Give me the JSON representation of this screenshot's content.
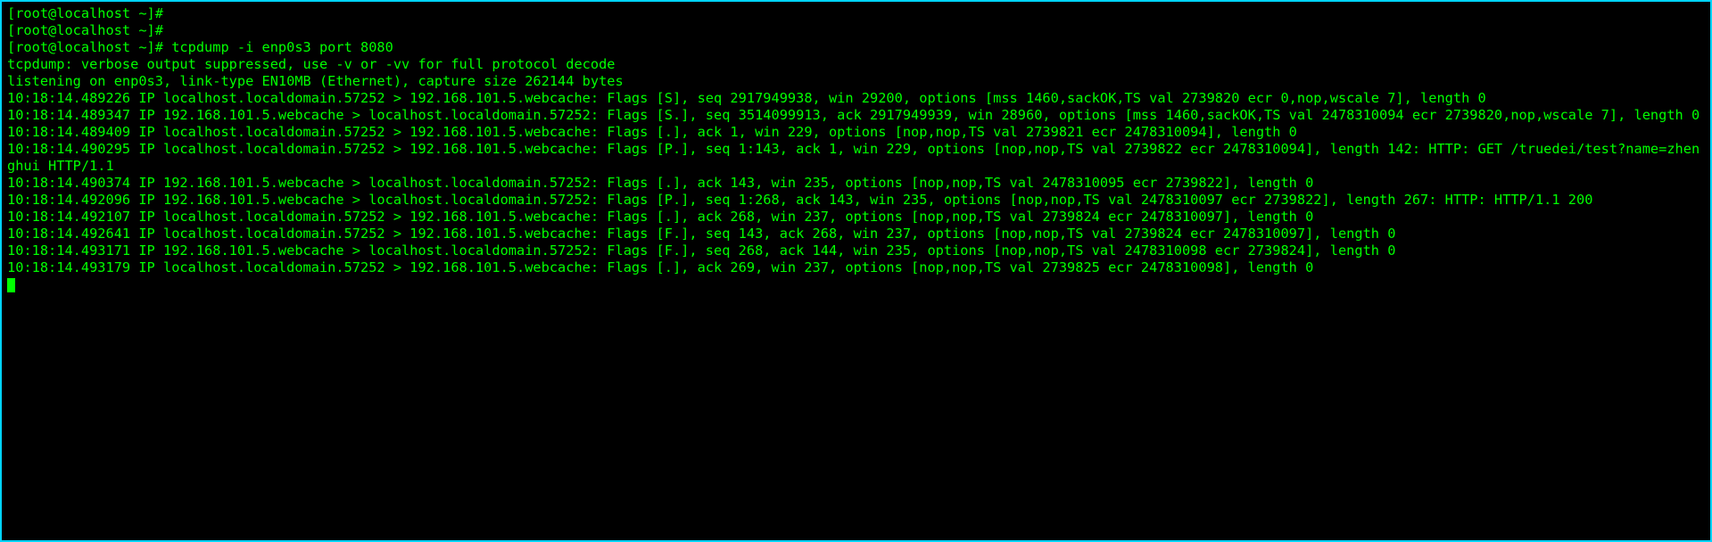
{
  "terminal": {
    "lines": [
      {
        "prompt": "[root@localhost ~]#",
        "cmd": " "
      },
      {
        "prompt": "[root@localhost ~]#",
        "cmd": " "
      },
      {
        "prompt": "[root@localhost ~]#",
        "cmd": " tcpdump -i enp0s3 port 8080"
      },
      {
        "text": "tcpdump: verbose output suppressed, use -v or -vv for full protocol decode"
      },
      {
        "text": "listening on enp0s3, link-type EN10MB (Ethernet), capture size 262144 bytes"
      },
      {
        "text": "10:18:14.489226 IP localhost.localdomain.57252 > 192.168.101.5.webcache: Flags [S], seq 2917949938, win 29200, options [mss 1460,sackOK,TS val 2739820 ecr 0,nop,wscale 7], length 0"
      },
      {
        "text": "10:18:14.489347 IP 192.168.101.5.webcache > localhost.localdomain.57252: Flags [S.], seq 3514099913, ack 2917949939, win 28960, options [mss 1460,sackOK,TS val 2478310094 ecr 2739820,nop,wscale 7], length 0"
      },
      {
        "text": "10:18:14.489409 IP localhost.localdomain.57252 > 192.168.101.5.webcache: Flags [.], ack 1, win 229, options [nop,nop,TS val 2739821 ecr 2478310094], length 0"
      },
      {
        "text": "10:18:14.490295 IP localhost.localdomain.57252 > 192.168.101.5.webcache: Flags [P.], seq 1:143, ack 1, win 229, options [nop,nop,TS val 2739822 ecr 2478310094], length 142: HTTP: GET /truedei/test?name=zhenghui HTTP/1.1"
      },
      {
        "text": "10:18:14.490374 IP 192.168.101.5.webcache > localhost.localdomain.57252: Flags [.], ack 143, win 235, options [nop,nop,TS val 2478310095 ecr 2739822], length 0"
      },
      {
        "text": "10:18:14.492096 IP 192.168.101.5.webcache > localhost.localdomain.57252: Flags [P.], seq 1:268, ack 143, win 235, options [nop,nop,TS val 2478310097 ecr 2739822], length 267: HTTP: HTTP/1.1 200"
      },
      {
        "text": "10:18:14.492107 IP localhost.localdomain.57252 > 192.168.101.5.webcache: Flags [.], ack 268, win 237, options [nop,nop,TS val 2739824 ecr 2478310097], length 0"
      },
      {
        "text": "10:18:14.492641 IP localhost.localdomain.57252 > 192.168.101.5.webcache: Flags [F.], seq 143, ack 268, win 237, options [nop,nop,TS val 2739824 ecr 2478310097], length 0"
      },
      {
        "text": "10:18:14.493171 IP 192.168.101.5.webcache > localhost.localdomain.57252: Flags [F.], seq 268, ack 144, win 235, options [nop,nop,TS val 2478310098 ecr 2739824], length 0"
      },
      {
        "text": "10:18:14.493179 IP localhost.localdomain.57252 > 192.168.101.5.webcache: Flags [.], ack 269, win 237, options [nop,nop,TS val 2739825 ecr 2478310098], length 0"
      }
    ]
  }
}
